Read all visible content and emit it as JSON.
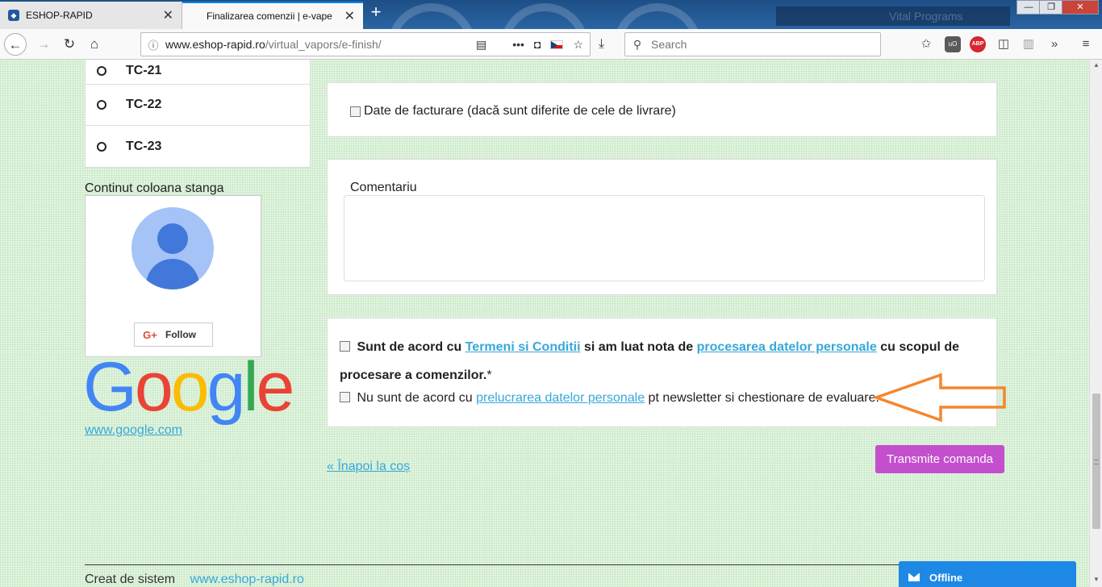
{
  "browser": {
    "tabs": [
      {
        "label": "ESHOP-RAPID",
        "active": false
      },
      {
        "label": "Finalizarea comenzii | e-vape",
        "active": true
      }
    ],
    "new_tab": "+",
    "tab_close": "✕",
    "url_host": "www.eshop-rapid.ro",
    "url_path": "/virtual_vapors/e-finish/",
    "search_placeholder": "Search",
    "banner_text": "Vital Programs",
    "win_min": "—",
    "win_max": "❐",
    "win_close": "✕"
  },
  "sidebar": {
    "tc_items": [
      "TC-21",
      "TC-22",
      "TC-23"
    ],
    "left_column_title": "Continut coloana stanga",
    "follow_label": "Follow",
    "gplus_label": "G+",
    "google_logo_text": [
      "G",
      "o",
      "o",
      "g",
      "l",
      "e"
    ],
    "google_link": "www.google.com"
  },
  "form": {
    "billing_label": "Date de facturare (dacă sunt diferite de cele de livrare)",
    "comment_label": "Comentariu",
    "consent1_pre": "Sunt de acord cu ",
    "consent1_link1": "Termeni si Conditii",
    "consent1_mid": " si am luat nota de ",
    "consent1_link2": "procesarea datelor personale",
    "consent1_post": " cu scopul de procesare a comenzilor.",
    "consent1_required": "*",
    "consent2_pre": "Nu sunt de acord cu ",
    "consent2_link": "prelucrarea datelor personale",
    "consent2_post": " pt newsletter si chestionare de evaluare.",
    "back_link": "« Înapoi la coș",
    "submit_label": "Transmite comanda"
  },
  "footer": {
    "created_by": "Creat de sistem",
    "site_link": "www.eshop-rapid.ro"
  },
  "chat": {
    "status": "Offline"
  },
  "colors": {
    "accent_link": "#37a8d8",
    "submit_button": "#c34fcd",
    "annotation_arrow": "#f5862d",
    "chat_widget": "#1e88e5"
  }
}
